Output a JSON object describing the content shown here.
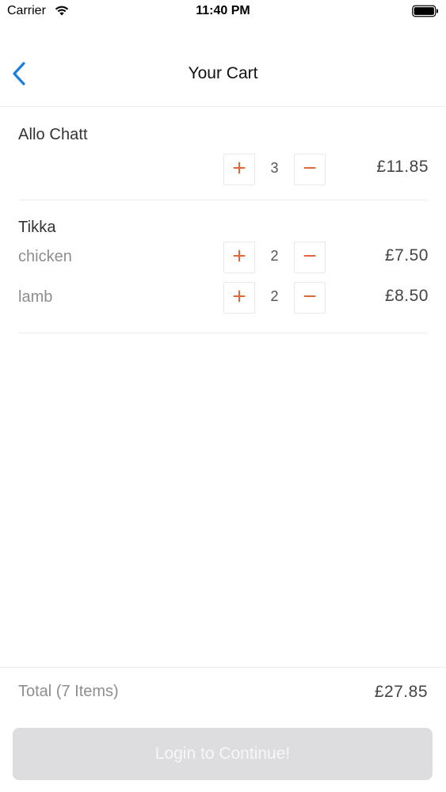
{
  "status_bar": {
    "carrier": "Carrier",
    "time": "11:40 PM"
  },
  "nav": {
    "title": "Your Cart"
  },
  "cart": {
    "sections": [
      {
        "title": "Allo Chatt",
        "items": [
          {
            "name": "",
            "quantity": "3",
            "price": "£11.85"
          }
        ]
      },
      {
        "title": "Tikka",
        "items": [
          {
            "name": "chicken",
            "quantity": "2",
            "price": "£7.50"
          },
          {
            "name": "lamb",
            "quantity": "2",
            "price": "£8.50"
          }
        ]
      }
    ]
  },
  "footer": {
    "total_label": "Total (7 Items)",
    "total_price": "£27.85",
    "continue_label": "Login to Continue!"
  },
  "colors": {
    "accent": "#1a7ee0",
    "qty_button_glyph": "#e2643a",
    "disabled_button": "#dddcdf"
  },
  "icons": {
    "back": "chevron-left-icon",
    "plus": "plus-icon",
    "minus": "minus-icon"
  }
}
